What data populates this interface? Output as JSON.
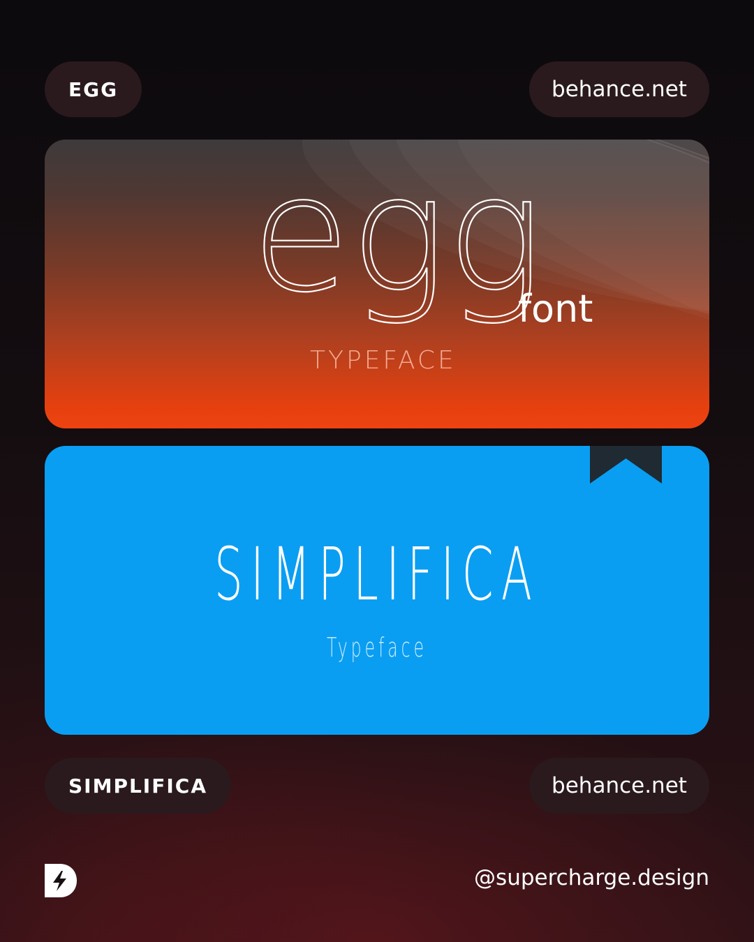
{
  "top_row": {
    "tag_label": "EGG",
    "source_label": "behance.net"
  },
  "egg_card": {
    "word": "egg",
    "font_label": "font",
    "typeface_label": "TYPEFACE",
    "gradient_top": "#3e3a3b",
    "gradient_bottom": "#ee4310"
  },
  "simplifica_card": {
    "title": "SIMPLIFICA",
    "subtitle": "Typeface",
    "background": "#0a9ef2",
    "bookmark_icon": "bookmark-icon"
  },
  "bottom_row": {
    "tag_label": "SIMPLIFICA",
    "source_label": "behance.net"
  },
  "footer": {
    "logo_icon": "lightning-d-logo",
    "handle": "@supercharge.design"
  },
  "colors": {
    "pill_background": "#2a1a1e",
    "accent_orange": "#ee4310",
    "accent_blue": "#0a9ef2"
  }
}
